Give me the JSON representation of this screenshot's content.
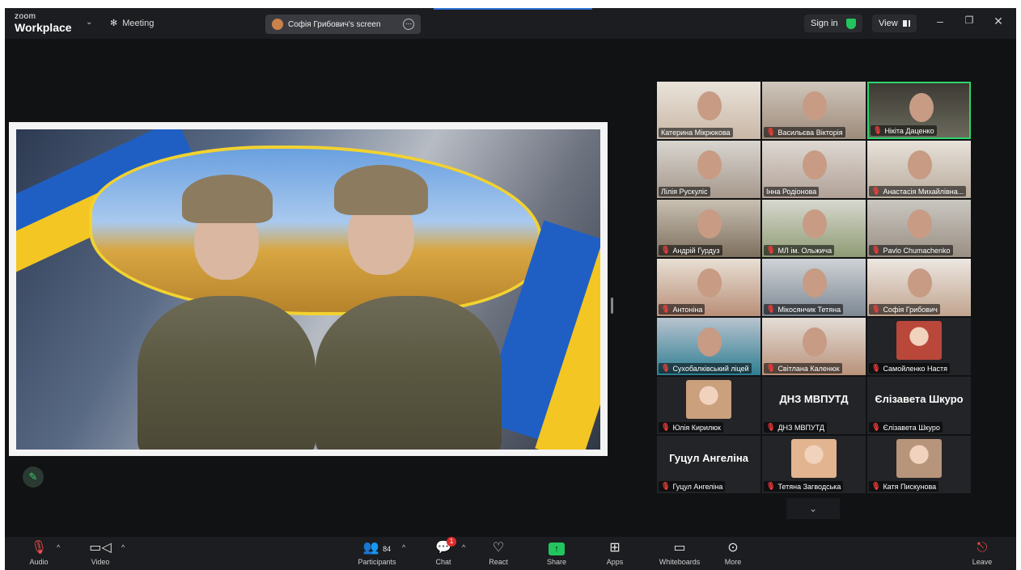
{
  "titlebar": {
    "logo_small": "zoom",
    "logo_big": "Workplace",
    "meeting_label": "Meeting",
    "screen_share_label": "Софія Грибович's screen",
    "sign_in_label": "Sign in",
    "view_label": "View"
  },
  "gallery": {
    "tiles": [
      {
        "name": "Катерина Мікрюкова",
        "muted": false
      },
      {
        "name": "Васильєва Вікторія",
        "muted": true
      },
      {
        "name": "Нікіта Даценко",
        "muted": true,
        "active": true
      },
      {
        "name": "Лілія Рускуліс",
        "muted": false
      },
      {
        "name": "Інна Родіонова",
        "muted": false
      },
      {
        "name": "Анастасія Михайлівна...",
        "muted": true
      },
      {
        "name": "Андрій Гурдуз",
        "muted": true
      },
      {
        "name": "МЛ ім. Ольжича",
        "muted": true
      },
      {
        "name": "Pavlo Chumachenko",
        "muted": true
      },
      {
        "name": "Антоніна",
        "muted": true
      },
      {
        "name": "Мікосянчик Тетяна",
        "muted": true
      },
      {
        "name": "Софія Грибович",
        "muted": true
      },
      {
        "name": "Сухобалківський ліцей",
        "muted": true
      },
      {
        "name": "Світлана Каленюк",
        "muted": true
      },
      {
        "name": "Самойленко Настя",
        "muted": true
      },
      {
        "name": "Юлія Кирилюк",
        "muted": true
      },
      {
        "name": "ДНЗ МВПУТД",
        "muted": true,
        "big_name": "ДНЗ МВПУТД"
      },
      {
        "name": "Єлізавета Шкуро",
        "muted": true,
        "big_name": "Єлізавета Шкуро"
      },
      {
        "name": "Гуцул Ангеліна",
        "muted": true,
        "big_name": "Гуцул Ангеліна"
      },
      {
        "name": "Тетяна Загводська",
        "muted": true
      },
      {
        "name": "Катя Пискунова",
        "muted": true
      }
    ]
  },
  "toolbar": {
    "audio_label": "Audio",
    "video_label": "Video",
    "participants_label": "Participants",
    "participants_count": "84",
    "chat_label": "Chat",
    "chat_badge": "1",
    "react_label": "React",
    "share_label": "Share",
    "apps_label": "Apps",
    "whiteboards_label": "Whiteboards",
    "more_label": "More",
    "leave_label": "Leave"
  },
  "colors": {
    "accent_green": "#22c55e",
    "active_border": "#2fd36b",
    "muted_red": "#ff3b3b",
    "badge_red": "#e02c2c"
  }
}
